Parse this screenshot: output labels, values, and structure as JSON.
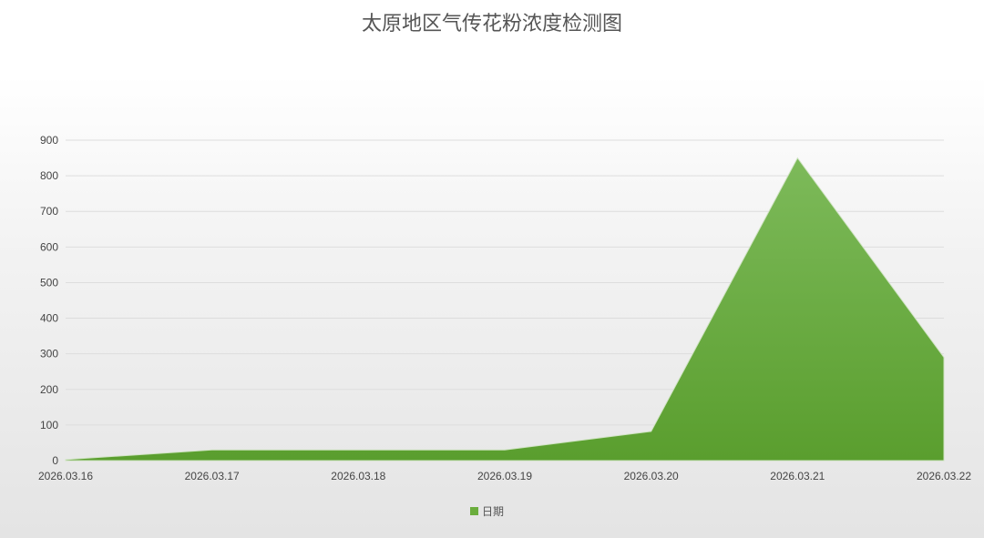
{
  "chart_data": {
    "type": "area",
    "title": "太原地区气传花粉浓度检测图",
    "xlabel": "",
    "ylabel": "",
    "x": [
      "2026.03.16",
      "2026.03.17",
      "2026.03.18",
      "2026.03.19",
      "2026.03.20",
      "2026.03.21",
      "2026.03.22"
    ],
    "series": [
      {
        "name": "日期",
        "values": [
          3,
          30,
          30,
          30,
          82,
          850,
          290
        ]
      }
    ],
    "ylim": [
      0,
      900
    ],
    "yticks": [
      0,
      100,
      200,
      300,
      400,
      500,
      600,
      700,
      800,
      900
    ],
    "grid": true,
    "legend_position": "bottom",
    "colors": {
      "fill_top": "#7dba5a",
      "fill_bottom": "#5a9e2e",
      "legend": "#6aad3d",
      "grid": "#dddddd"
    }
  }
}
